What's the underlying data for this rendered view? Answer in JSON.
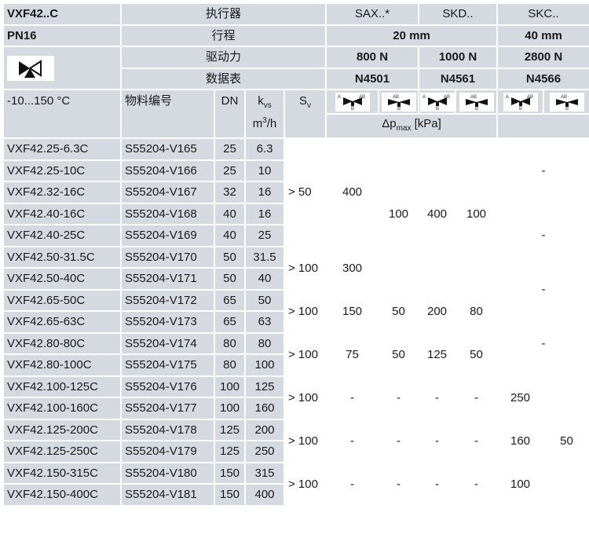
{
  "header": {
    "model": "VXF42..C",
    "actuator_label": "执行器",
    "sax": "SAX..*",
    "skd": "SKD..",
    "skc": "SKC..",
    "pn": "PN16",
    "stroke_label": "行程",
    "stroke_sax_skd": "20 mm",
    "stroke_skc": "40 mm",
    "force_label": "驱动力",
    "force_sax": "800 N",
    "force_skd": "1000 N",
    "force_skc": "2800 N",
    "datasheet_label": "数据表",
    "ds_sax": "N4501",
    "ds_skd": "N4561",
    "ds_skc": "N4566"
  },
  "subheader": {
    "temp": "-10...150 °C",
    "part_no": "物料编号",
    "dn": "DN",
    "kvs_k": "k",
    "kvs_sub": "vs",
    "kvs_unit_main": "m",
    "kvs_unit_sup": "3",
    "kvs_unit_tail": "/h",
    "sv_s": "S",
    "sv_sub": "v",
    "dp_delta": "Δp",
    "dp_sub": "max",
    "dp_unit": " [kPa]",
    "port_a_ab": "A",
    "port_ab": "AB",
    "port_b": "B"
  },
  "rows": [
    {
      "type": "VXF42.25-6.3C",
      "part": "S55204-V165",
      "dn": "25",
      "kvs": "6.3"
    },
    {
      "type": "VXF42.25-10C",
      "part": "S55204-V166",
      "dn": "25",
      "kvs": "10"
    },
    {
      "type": "VXF42.32-16C",
      "part": "S55204-V167",
      "dn": "32",
      "kvs": "16"
    },
    {
      "type": "VXF42.40-16C",
      "part": "S55204-V168",
      "dn": "40",
      "kvs": "16"
    },
    {
      "type": "VXF42.40-25C",
      "part": "S55204-V169",
      "dn": "40",
      "kvs": "25"
    },
    {
      "type": "VXF42.50-31.5C",
      "part": "S55204-V170",
      "dn": "50",
      "kvs": "31.5"
    },
    {
      "type": "VXF42.50-40C",
      "part": "S55204-V171",
      "dn": "50",
      "kvs": "40"
    },
    {
      "type": "VXF42.65-50C",
      "part": "S55204-V172",
      "dn": "65",
      "kvs": "50"
    },
    {
      "type": "VXF42.65-63C",
      "part": "S55204-V173",
      "dn": "65",
      "kvs": "63"
    },
    {
      "type": "VXF42.80-80C",
      "part": "S55204-V174",
      "dn": "80",
      "kvs": "80"
    },
    {
      "type": "VXF42.80-100C",
      "part": "S55204-V175",
      "dn": "80",
      "kvs": "100"
    },
    {
      "type": "VXF42.100-125C",
      "part": "S55204-V176",
      "dn": "100",
      "kvs": "125"
    },
    {
      "type": "VXF42.100-160C",
      "part": "S55204-V177",
      "dn": "100",
      "kvs": "160"
    },
    {
      "type": "VXF42.125-200C",
      "part": "S55204-V178",
      "dn": "125",
      "kvs": "200"
    },
    {
      "type": "VXF42.125-250C",
      "part": "S55204-V179",
      "dn": "125",
      "kvs": "250"
    },
    {
      "type": "VXF42.150-315C",
      "part": "S55204-V180",
      "dn": "150",
      "kvs": "315"
    },
    {
      "type": "VXF42.150-400C",
      "part": "S55204-V181",
      "dn": "150",
      "kvs": "400"
    }
  ],
  "sv": {
    "g1": "> 50",
    "g2": "> 100",
    "g3": "> 100",
    "g4": "> 100",
    "g5": "> 100",
    "g6": "> 100",
    "g7": "> 100"
  },
  "dp": {
    "sax1_a": "400",
    "sax1_b": "300",
    "skd_col1_top": "100",
    "skd_col2_top": "400",
    "skd_col3_top": "100",
    "g3": [
      "150",
      "50",
      "200",
      "80"
    ],
    "g4": [
      "75",
      "50",
      "125",
      "50"
    ],
    "g5": [
      "-",
      "-",
      "-",
      "-"
    ],
    "g6": [
      "-",
      "-",
      "-",
      "-"
    ],
    "g7": [
      "-",
      "-",
      "-",
      "-"
    ],
    "skc_dash": "-",
    "skc_g5": "250",
    "skc_g6": "160",
    "skc_g7": "100",
    "skc_right": "50"
  }
}
